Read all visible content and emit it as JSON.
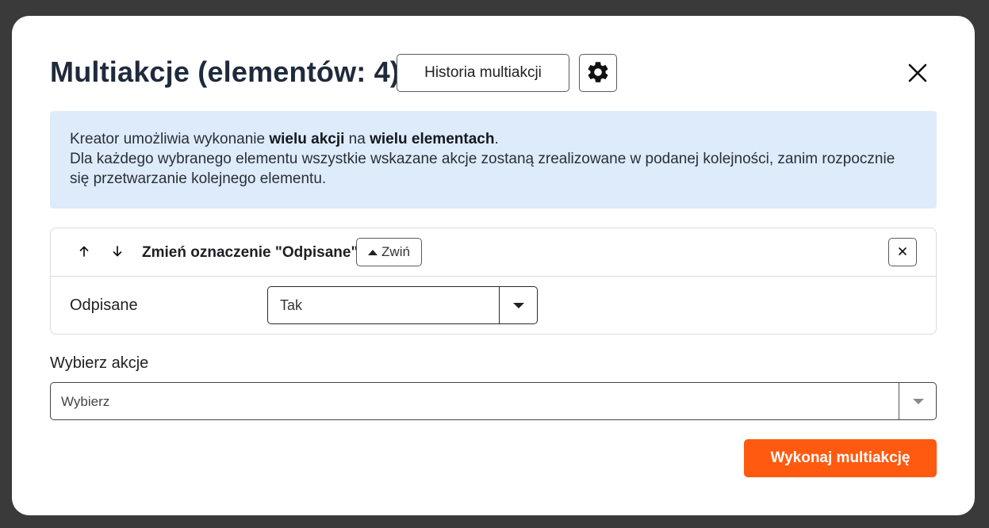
{
  "modal": {
    "title": "Multiakcje (elementów: 4)",
    "history_button": "Historia multiakcji",
    "settings_icon": "gear-icon",
    "close_icon": "close-icon"
  },
  "info": {
    "line1_prefix": "Kreator umożliwia wykonanie ",
    "line1_bold1": "wielu akcji",
    "line1_mid": " na ",
    "line1_bold2": "wielu elementach",
    "line1_suffix": ".",
    "line2": "Dla każdego wybranego elementu wszystkie wskazane akcje zostaną zrealizowane w podanej kolejności, zanim rozpocznie się przetwarzanie kolejnego elementu."
  },
  "action_card": {
    "title": "Zmień oznaczenie \"Odpisane\"",
    "collapse_label": "Zwiń",
    "field_label": "Odpisane",
    "field_value": "Tak"
  },
  "choose_action": {
    "label": "Wybierz akcje",
    "placeholder": "Wybierz"
  },
  "footer": {
    "run_button": "Wykonaj multiakcję"
  },
  "colors": {
    "accent": "#ff5a0f",
    "info_background": "#ddebfb",
    "title_text": "#1f2a3c"
  }
}
